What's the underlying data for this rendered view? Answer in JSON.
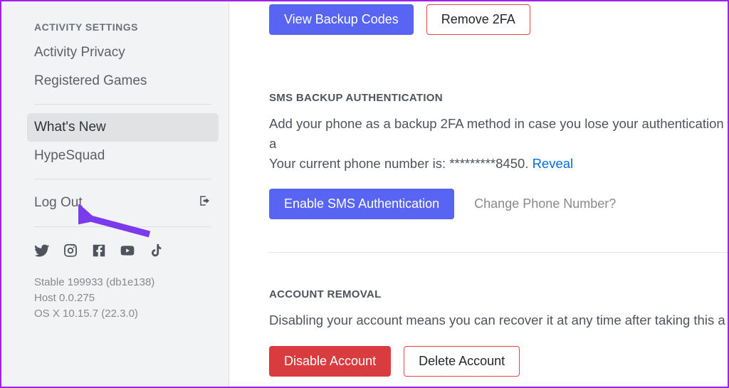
{
  "sidebar": {
    "heading": "ACTIVITY SETTINGS",
    "items": [
      {
        "label": "Activity Privacy"
      },
      {
        "label": "Registered Games"
      }
    ],
    "items2": [
      {
        "label": "What's New",
        "selected": true
      },
      {
        "label": "HypeSquad"
      }
    ],
    "logout": "Log Out",
    "version": {
      "line1": "Stable 199933 (db1e138)",
      "line2": "Host 0.0.275",
      "line3": "OS X 10.15.7 (22.3.0)"
    }
  },
  "twofa": {
    "view_backup": "View Backup Codes",
    "remove": "Remove 2FA"
  },
  "sms": {
    "heading": "SMS BACKUP AUTHENTICATION",
    "desc_pre": "Add your phone as a backup 2FA method in case you lose your authentication a",
    "desc_line2_pre": "Your current phone number is: *********8450. ",
    "reveal": "Reveal",
    "enable_btn": "Enable SMS Authentication",
    "change_phone": "Change Phone Number?"
  },
  "removal": {
    "heading": "ACCOUNT REMOVAL",
    "desc": "Disabling your account means you can recover it at any time after taking this a",
    "disable": "Disable Account",
    "delete": "Delete Account"
  }
}
